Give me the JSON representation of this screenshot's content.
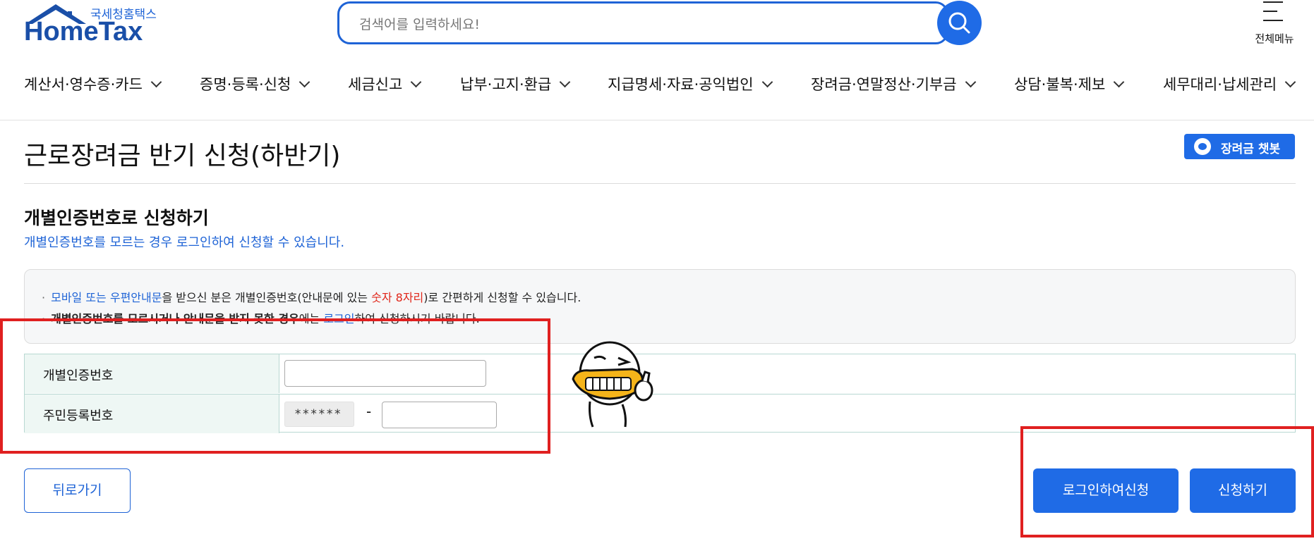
{
  "header": {
    "logo_korean": "국세청홈택스",
    "logo_text": "HomeTax",
    "search_placeholder": "검색어를 입력하세요!",
    "all_menu_label": "전체메뉴"
  },
  "nav": {
    "items": [
      {
        "label": "계산서·영수증·카드"
      },
      {
        "label": "증명·등록·신청"
      },
      {
        "label": "세금신고"
      },
      {
        "label": "납부·고지·환급"
      },
      {
        "label": "지급명세·자료·공익법인"
      },
      {
        "label": "장려금·연말정산·기부금"
      },
      {
        "label": "상담·불복·제보"
      },
      {
        "label": "세무대리·납세관리"
      }
    ]
  },
  "page": {
    "title": "근로장려금 반기 신청(하반기)",
    "chatbot_label": "장려금 챗봇",
    "section_title": "개별인증번호로 신청하기",
    "section_subtitle": "개별인증번호를 모르는 경우 로그인하여 신청할 수 있습니다."
  },
  "notice": {
    "line1": {
      "p1": "모바일 또는 우편안내문",
      "p2": "을 받으신 분은 개별인증번호(안내문에 있는 ",
      "p3": "숫자 8자리",
      "p4": ")로 간편하게 신청할 수 있습니다."
    },
    "line2": {
      "p1": "개별인증번호를 모르시거나 안내문을 받지 못한 경우",
      "p2": "에는 ",
      "p3": "로그인",
      "p4": "하여 신청하시기 바랍니다."
    }
  },
  "form": {
    "personal_code_label": "개별인증번호",
    "personal_code_value": "",
    "rrn_label": "주민등록번호",
    "rrn_front": "******",
    "rrn_separator": "-",
    "rrn_back_value": ""
  },
  "buttons": {
    "back": "뒤로가기",
    "login_apply": "로그인하여신청",
    "apply": "신청하기"
  },
  "colors": {
    "primary": "#1f6be6",
    "logo": "#1a4fa8",
    "highlight_red": "#e0261a",
    "annotation_red": "#e02020",
    "table_header_bg": "#eef7f4"
  }
}
